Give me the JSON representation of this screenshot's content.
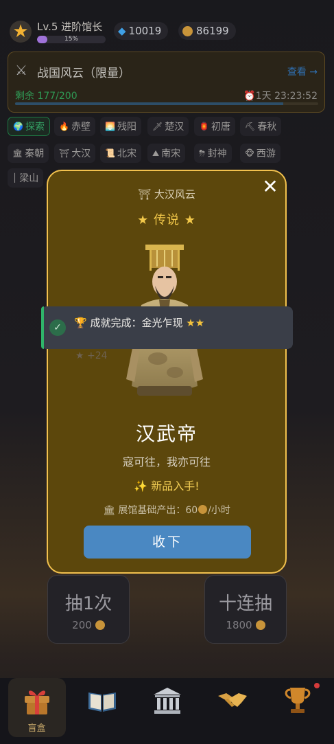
{
  "header": {
    "level_text": "Lv.5 进阶馆长",
    "level_progress_pct": 15,
    "level_progress_label": "15%",
    "gems": "10019",
    "coins": "86199"
  },
  "event": {
    "title": "战国风云（限量）",
    "view_label": "查看 →",
    "remaining": "剩余 177/200",
    "remaining_fraction": 0.885,
    "timer": "1天 23:23:52"
  },
  "tags": [
    "探索",
    "赤壁",
    "残阳",
    "楚汉",
    "初唐",
    "春秋",
    "秦朝",
    "大汉",
    "北宋",
    "南宋",
    "封神",
    "西游",
    "梁山"
  ],
  "modal": {
    "series": "大汉风云",
    "rarity": "★ 传说 ★",
    "name": "汉武帝",
    "quote": "寇可往，我亦可往",
    "new_badge": "✨ 新品入手!",
    "output_prefix": "展馆基础产出：60",
    "output_suffix": "/小时",
    "accept_label": "收下",
    "close_symbol": "✕"
  },
  "toast": {
    "text": "成就完成：金光乍现",
    "stars": "★★",
    "ghost_text": "★ +24"
  },
  "draw": {
    "single_label": "抽1次",
    "single_cost": "200",
    "ten_label": "十连抽",
    "ten_cost": "1800"
  },
  "nav": {
    "items": [
      {
        "label": "盲盒",
        "icon": "gift-icon",
        "active": true
      },
      {
        "label": "",
        "icon": "book-icon",
        "active": false
      },
      {
        "label": "",
        "icon": "museum-icon",
        "active": false
      },
      {
        "label": "",
        "icon": "handshake-icon",
        "active": false
      },
      {
        "label": "",
        "icon": "trophy-icon",
        "active": false
      }
    ]
  },
  "colors": {
    "modal_bg": "#5c470c",
    "modal_border": "#f2c14e",
    "accent_blue": "#4a88c2",
    "success_green": "#2fb56a",
    "gold": "#f2c84a"
  }
}
